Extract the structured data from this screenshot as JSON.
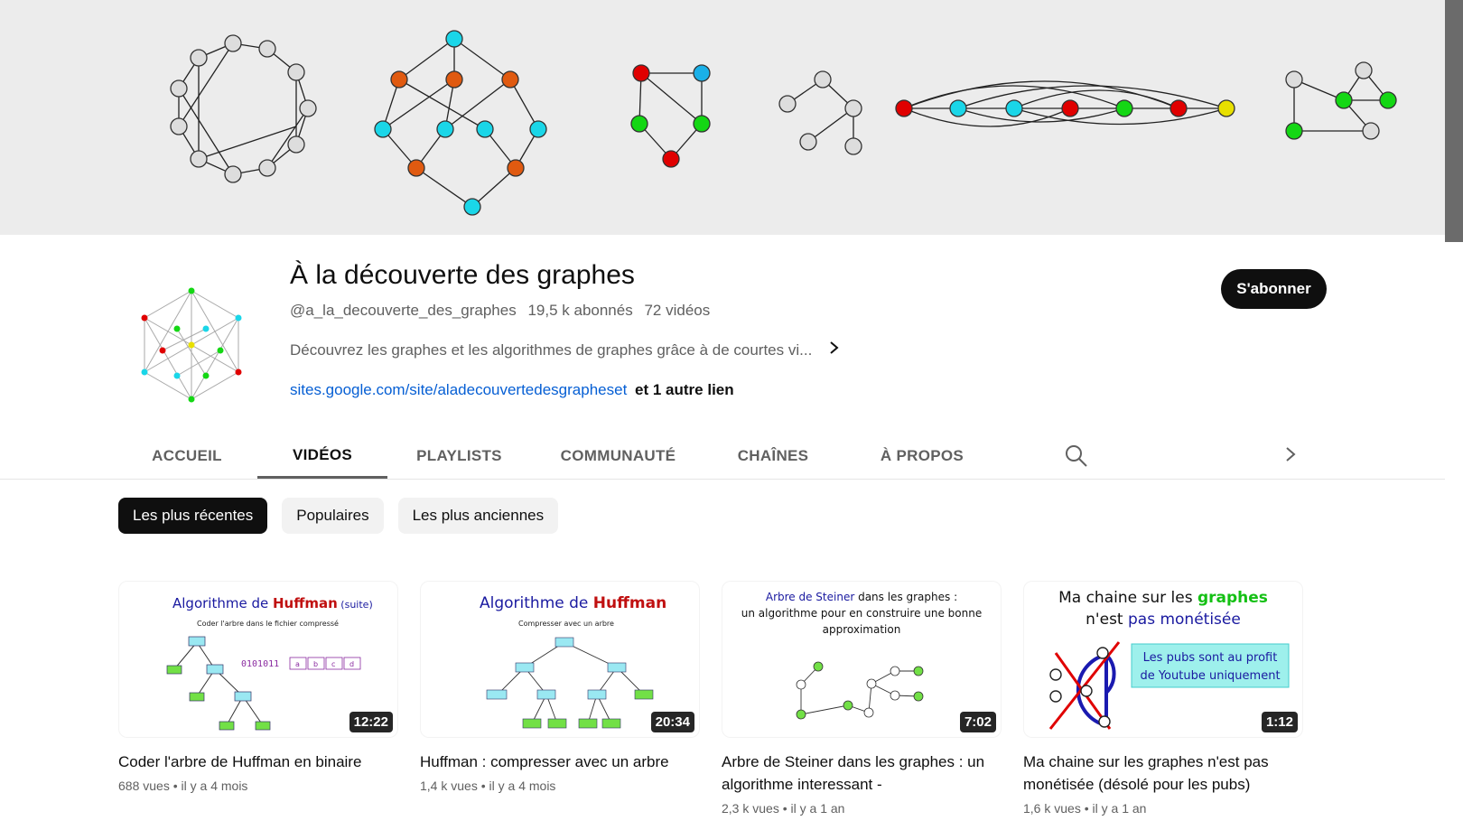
{
  "channel": {
    "name": "À la découverte des graphes",
    "handle": "@a_la_decouverte_des_graphes",
    "subscribers": "19,5 k abonnés",
    "videos_count": "72 vidéos",
    "description": "Découvrez les graphes et les algorithmes de graphes grâce à de courtes vi...",
    "link": "sites.google.com/site/aladecouvertedesgrapheset",
    "more_links": "et 1 autre lien",
    "subscribe_label": "S'abonner"
  },
  "tabs": [
    {
      "label": "ACCUEIL"
    },
    {
      "label": "VIDÉOS"
    },
    {
      "label": "PLAYLISTS"
    },
    {
      "label": "COMMUNAUTÉ"
    },
    {
      "label": "CHAÎNES"
    },
    {
      "label": "À PROPOS"
    }
  ],
  "active_tab": "VIDÉOS",
  "chips": [
    {
      "label": "Les plus récentes"
    },
    {
      "label": "Populaires"
    },
    {
      "label": "Les plus anciennes"
    }
  ],
  "active_chip": "Les plus récentes",
  "videos": [
    {
      "title": "Coder l'arbre de Huffman en binaire",
      "views": "688 vues",
      "age": "il y a 4 mois",
      "duration": "12:22",
      "thumb": {
        "line1a": "Algorithme de ",
        "line1b": "Huffman",
        "line1c": " (suite)",
        "sub": "Coder l'arbre dans le fichier compressé",
        "bits": "0101011",
        "letters": [
          "a",
          "b",
          "c",
          "d"
        ]
      }
    },
    {
      "title": "Huffman : compresser avec un arbre",
      "views": "1,4 k vues",
      "age": "il y a 4 mois",
      "duration": "20:34",
      "thumb": {
        "line1a": "Algorithme de ",
        "line1b": "Huffman",
        "sub": "Compresser avec un arbre"
      }
    },
    {
      "title": "Arbre de Steiner dans les graphes : un algorithme interessant -",
      "views": "2,3 k vues",
      "age": "il y a 1 an",
      "duration": "7:02",
      "thumb": {
        "line1a": "Arbre de Steiner",
        "line1b": " dans les graphes :",
        "line2": "un algorithme pour en construire une bonne",
        "line3": "approximation"
      }
    },
    {
      "title": "Ma chaine sur les graphes n'est pas monétisée (désolé pour les pubs)",
      "views": "1,6 k vues",
      "age": "il y a 1 an",
      "duration": "1:12",
      "thumb": {
        "line1a": "Ma chaine sur les ",
        "line1b": "graphes",
        "line2a": "n'est ",
        "line2b": "pas monétisée",
        "box1": "Les pubs sont au profit",
        "box2": "de Youtube uniquement"
      }
    }
  ],
  "colors": {
    "accent_red": "#e00000",
    "accent_cyan": "#1ad6e8",
    "accent_green": "#14d714",
    "accent_orange": "#e05a10",
    "link": "#065fd4"
  }
}
